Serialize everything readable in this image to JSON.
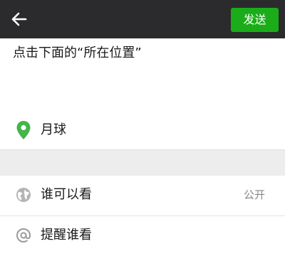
{
  "header": {
    "send_label": "发送"
  },
  "compose": {
    "text": "点击下面的“所在位置”"
  },
  "location": {
    "label": "月球"
  },
  "settings": {
    "visibility_label": "谁可以看",
    "visibility_value": "公开",
    "mention_label": "提醒谁看"
  },
  "colors": {
    "topbar": "#2b2b2d",
    "accent_green": "#1aad19",
    "location_green": "#44b549",
    "icon_gray": "#9a9a9a"
  },
  "icons": {
    "back": "arrow-left-icon",
    "location": "map-pin-icon",
    "visibility": "globe-icon",
    "mention": "at-sign-icon"
  }
}
